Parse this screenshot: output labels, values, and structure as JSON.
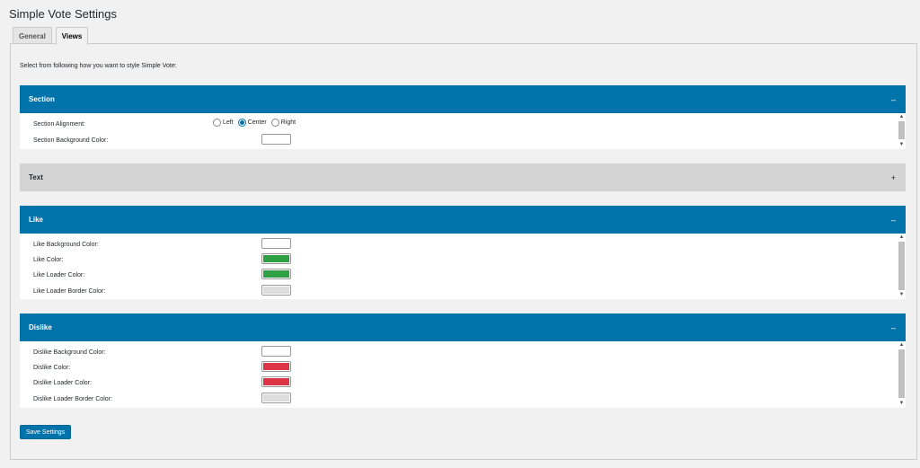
{
  "page": {
    "title": "Simple Vote Settings"
  },
  "tabs": [
    {
      "label": "General",
      "active": false
    },
    {
      "label": "Views",
      "active": true
    }
  ],
  "intro": "Select from following how you want to style Simple Vote:",
  "sections": {
    "section": {
      "title": "Section",
      "toggle": "–",
      "alignment_label": "Section Alignment:",
      "alignment_options": [
        "Left",
        "Center",
        "Right"
      ],
      "alignment_selected": "Center",
      "bg_label": "Section Background Color:",
      "bg_color": "#ffffff"
    },
    "text": {
      "title": "Text",
      "toggle": "+"
    },
    "like": {
      "title": "Like",
      "toggle": "–",
      "fields": [
        {
          "label": "Like Background Color:",
          "color": "#ffffff"
        },
        {
          "label": "Like Color:",
          "color": "#2ea043"
        },
        {
          "label": "Like Loader Color:",
          "color": "#2ea043"
        },
        {
          "label": "Like Loader Border Color:",
          "color": "#dddddd"
        }
      ]
    },
    "dislike": {
      "title": "Dislike",
      "toggle": "–",
      "fields": [
        {
          "label": "Dislike Background Color:",
          "color": "#ffffff"
        },
        {
          "label": "Dislike Color:",
          "color": "#dc3545"
        },
        {
          "label": "Dislike Loader Color:",
          "color": "#dc3545"
        },
        {
          "label": "Dislike Loader Border Color:",
          "color": "#dddddd"
        }
      ]
    }
  },
  "scroll_arrows": {
    "up": "▲",
    "down": "▼"
  },
  "save_label": "Save Settings",
  "colors": {
    "accent": "#0073aa",
    "closed_header": "#d4d4d4"
  }
}
